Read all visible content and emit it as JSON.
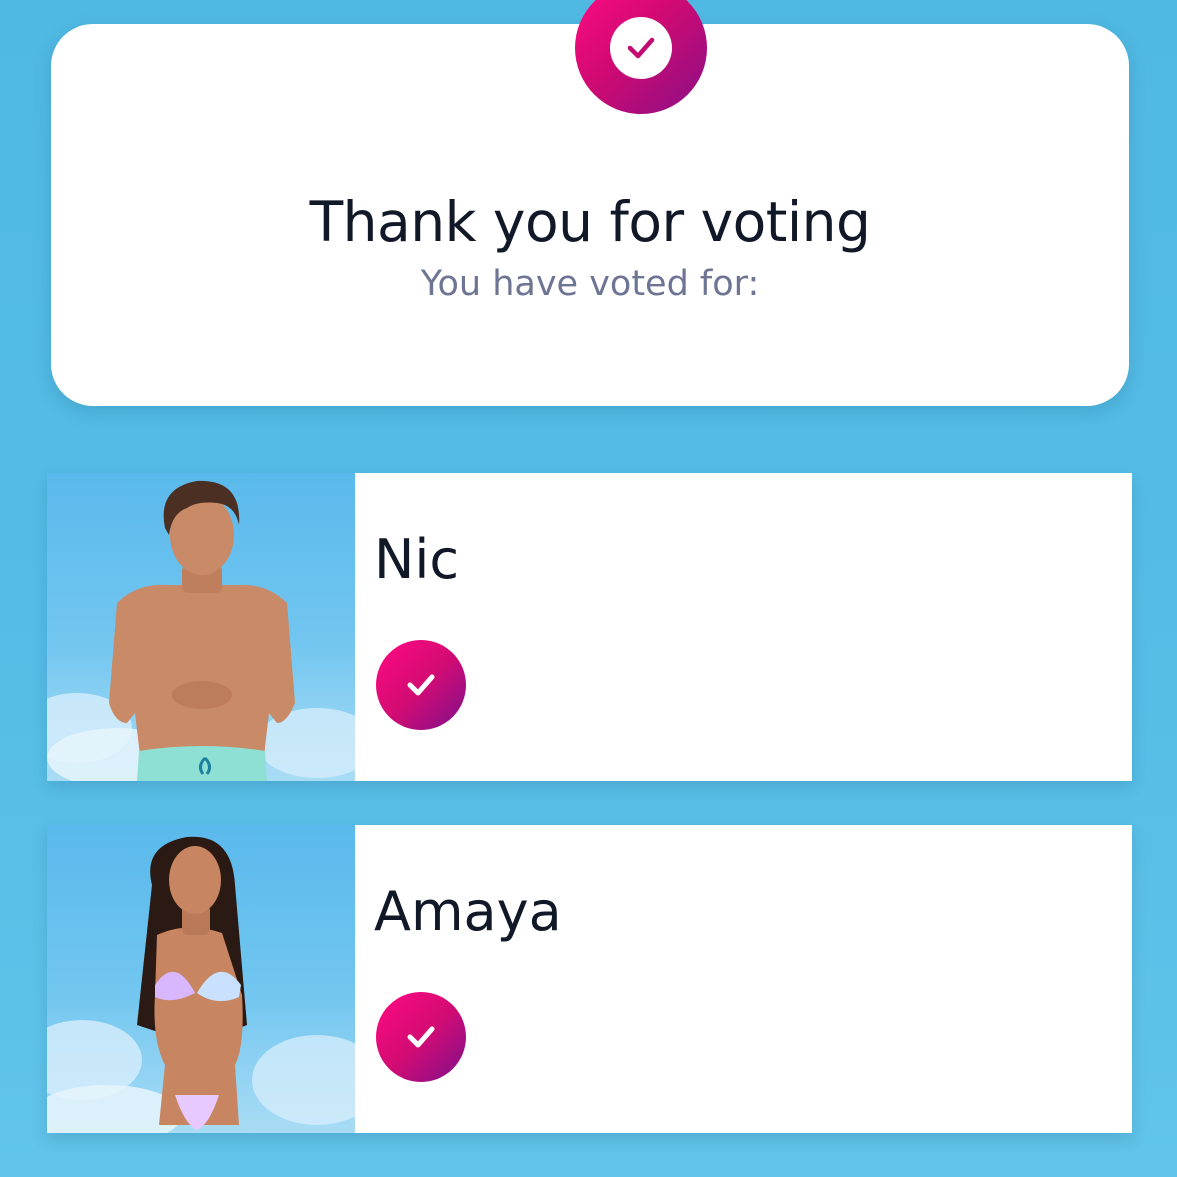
{
  "confirmation": {
    "title": "Thank you for voting",
    "subtitle": "You have voted for:",
    "badge_icon": "check-icon"
  },
  "votes": [
    {
      "name": "Nic",
      "selected": true,
      "icon": "check-icon"
    },
    {
      "name": "Amaya",
      "selected": true,
      "icon": "check-icon"
    }
  ],
  "colors": {
    "background": "#52BBE4",
    "accent_start": "#FF0A84",
    "accent_end": "#7E108C",
    "card": "#FFFFFF",
    "title_text": "#111827",
    "subtitle_text": "#6E7594"
  }
}
